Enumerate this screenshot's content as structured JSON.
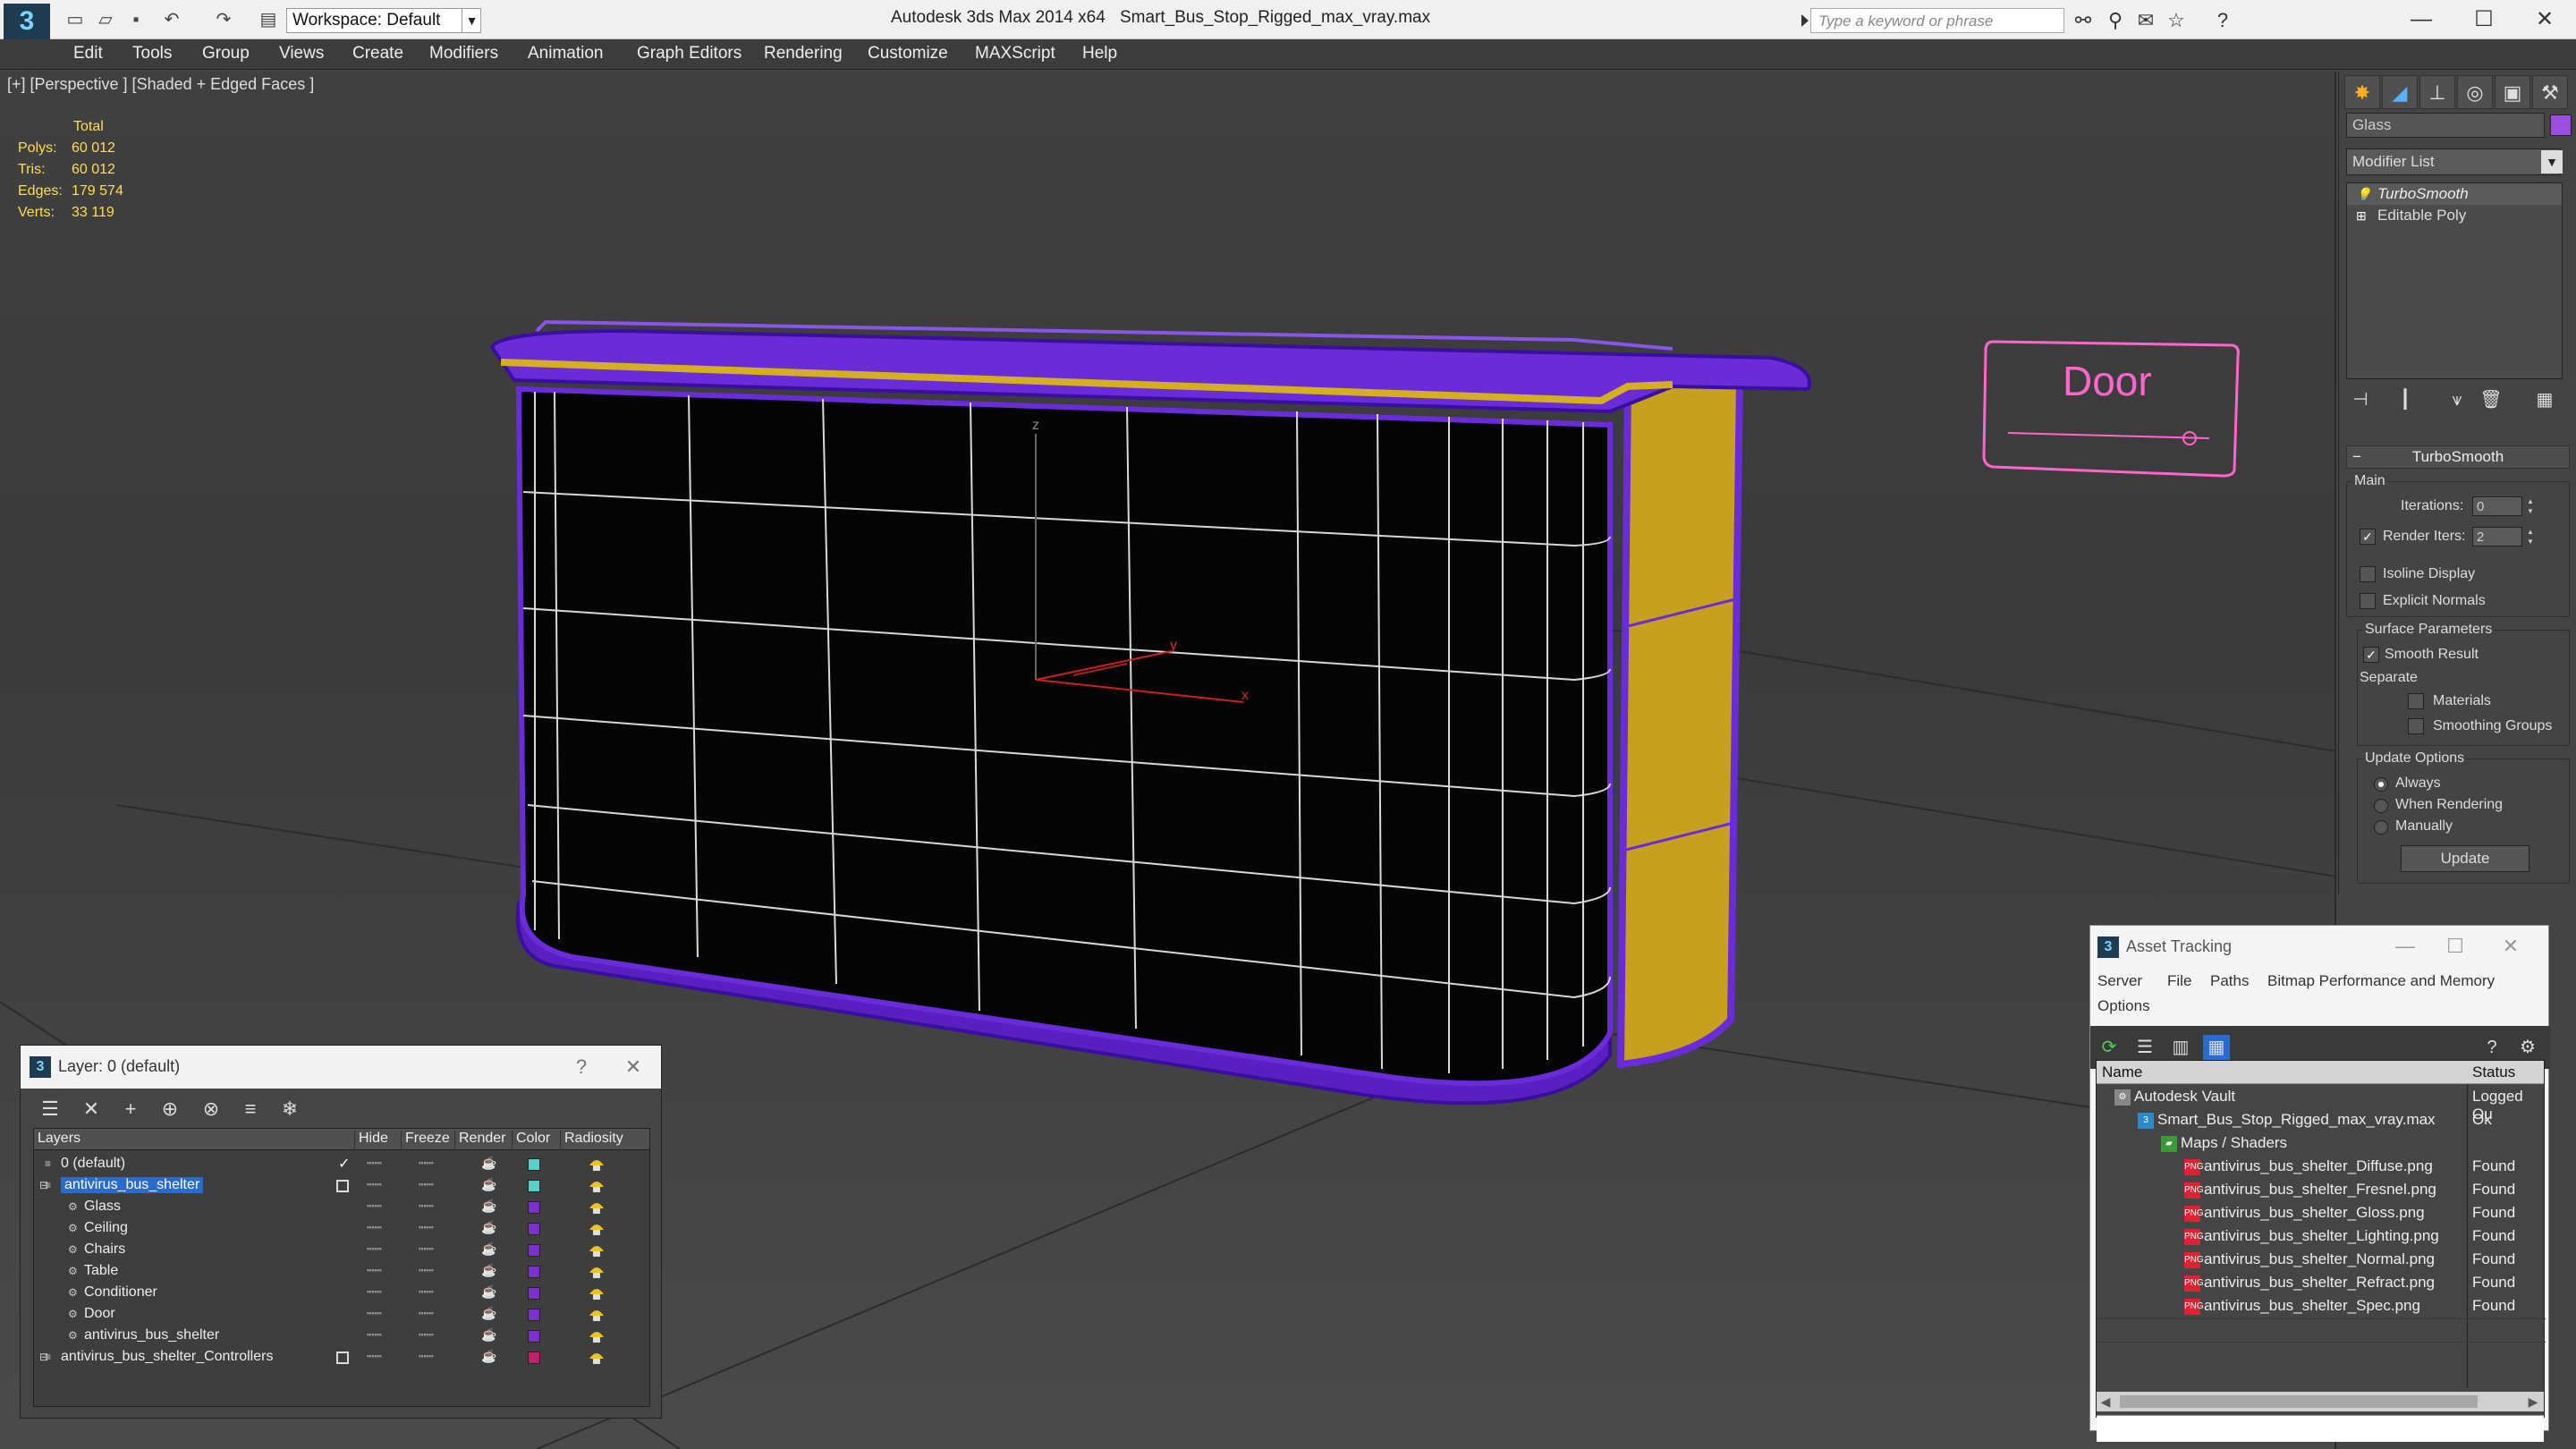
{
  "titlebar": {
    "workspace": "Workspace: Default",
    "app_title": "Autodesk 3ds Max  2014 x64",
    "file_title": "Smart_Bus_Stop_Rigged_max_vray.max",
    "search_placeholder": "Type a keyword or phrase"
  },
  "menu": [
    "Edit",
    "Tools",
    "Group",
    "Views",
    "Create",
    "Modifiers",
    "Animation",
    "Graph Editors",
    "Rendering",
    "Customize",
    "MAXScript",
    "Help"
  ],
  "viewport": {
    "label": "[+] [Perspective ] [Shaded + Edged Faces ]",
    "stats": {
      "header": "Total",
      "rows": [
        {
          "label": "Polys:",
          "value": "60 012"
        },
        {
          "label": "Tris:",
          "value": "60 012"
        },
        {
          "label": "Edges:",
          "value": "179 574"
        },
        {
          "label": "Verts:",
          "value": "33 119"
        }
      ]
    },
    "door_label": "Door",
    "axis_labels": {
      "z": "z",
      "y": "y",
      "x": "x"
    }
  },
  "command_panel": {
    "object_name": "Glass",
    "object_color": "#9b4fe0",
    "modifier_list": "Modifier List",
    "stack": [
      "TurboSmooth",
      "Editable Poly"
    ],
    "rollout_title": "TurboSmooth",
    "main_group": "Main",
    "iterations_label": "Iterations:",
    "iterations_value": "0",
    "render_iters_label": "Render Iters:",
    "render_iters_value": "2",
    "isoline_label": "Isoline Display",
    "explicit_label": "Explicit Normals",
    "surface_group": "Surface Parameters",
    "smooth_result_label": "Smooth Result",
    "separate_label": "Separate",
    "materials_label": "Materials",
    "smoothing_label": "Smoothing Groups",
    "update_group": "Update Options",
    "always_label": "Always",
    "when_rendering_label": "When Rendering",
    "manually_label": "Manually",
    "update_button": "Update"
  },
  "layer_dialog": {
    "title": "Layer: 0 (default)",
    "columns": [
      "Layers",
      "Hide",
      "Freeze",
      "Render",
      "Color",
      "Radiosity"
    ],
    "rows": [
      {
        "name": "0 (default)",
        "color": "#5ad1c8",
        "indent": 0
      },
      {
        "name": "antivirus_bus_shelter",
        "color": "#5ad1c8",
        "indent": 0
      },
      {
        "name": "Glass",
        "color": "#7a2fd0",
        "indent": 1
      },
      {
        "name": "Ceiling",
        "color": "#7a2fd0",
        "indent": 1
      },
      {
        "name": "Chairs",
        "color": "#7a2fd0",
        "indent": 1
      },
      {
        "name": "Table",
        "color": "#7a2fd0",
        "indent": 1
      },
      {
        "name": "Conditioner",
        "color": "#7a2fd0",
        "indent": 1
      },
      {
        "name": "Door",
        "color": "#7a2fd0",
        "indent": 1
      },
      {
        "name": "antivirus_bus_shelter",
        "color": "#7a2fd0",
        "indent": 1
      },
      {
        "name": "antivirus_bus_shelter_Controllers",
        "color": "#c0206a",
        "indent": 0
      }
    ]
  },
  "asset_tracking": {
    "title": "Asset Tracking",
    "menu": [
      "Server",
      "File",
      "Paths",
      "Bitmap Performance and Memory",
      "Options"
    ],
    "columns": [
      "Name",
      "Status"
    ],
    "rows": [
      {
        "name": "Autodesk Vault",
        "status": "Logged Ou",
        "indent": 0
      },
      {
        "name": "Smart_Bus_Stop_Rigged_max_vray.max",
        "status": "Ok",
        "indent": 1
      },
      {
        "name": "Maps / Shaders",
        "status": "",
        "indent": 2
      },
      {
        "name": "antivirus_bus_shelter_Diffuse.png",
        "status": "Found",
        "indent": 3
      },
      {
        "name": "antivirus_bus_shelter_Fresnel.png",
        "status": "Found",
        "indent": 3
      },
      {
        "name": "antivirus_bus_shelter_Gloss.png",
        "status": "Found",
        "indent": 3
      },
      {
        "name": "antivirus_bus_shelter_Lighting.png",
        "status": "Found",
        "indent": 3
      },
      {
        "name": "antivirus_bus_shelter_Normal.png",
        "status": "Found",
        "indent": 3
      },
      {
        "name": "antivirus_bus_shelter_Refract.png",
        "status": "Found",
        "indent": 3
      },
      {
        "name": "antivirus_bus_shelter_Spec.png",
        "status": "Found",
        "indent": 3
      }
    ]
  },
  "colors": {
    "accent_purple": "#6a2bd8",
    "accent_yellow": "#c8a020",
    "selection_blue": "#2a6bd0"
  }
}
